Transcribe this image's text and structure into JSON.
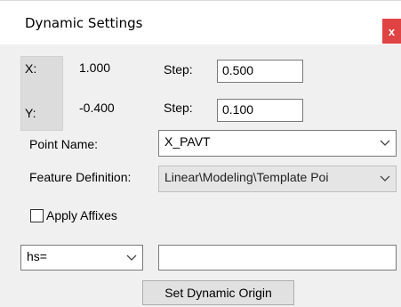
{
  "window": {
    "title": "Dynamic Settings",
    "close_label": "x"
  },
  "coords": {
    "x_label": "X:",
    "x_value": "1.000",
    "y_label": "Y:",
    "y_value": "-0.400",
    "x_step_label": "Step:",
    "x_step_value": "0.500",
    "y_step_label": "Step:",
    "y_step_value": "0.100"
  },
  "point_name": {
    "label": "Point Name:",
    "value": "X_PAVT"
  },
  "feature_definition": {
    "label": "Feature Definition:",
    "value": "Linear\\Modeling\\Template Poi"
  },
  "affixes": {
    "label": "Apply Affixes",
    "checked": false
  },
  "prefix": {
    "selected": "hs=",
    "text_value": ""
  },
  "buttons": {
    "set_origin": "Set Dynamic Origin"
  },
  "colors": {
    "close_button": "#e04343",
    "background": "#f0f0f0"
  }
}
